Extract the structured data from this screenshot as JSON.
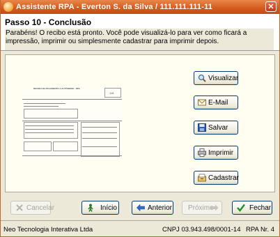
{
  "window": {
    "title": "Assistente RPA - Everton S. da Silva / 111.111.111-11",
    "close_label": "✕"
  },
  "step": {
    "title": "Passo 10 -  Conclusão",
    "description": "Parabéns! O recibo está pronto. Você pode visualizá-lo para ver como ficará a impressão, imprimir ou simplesmente cadastrar para imprimir depois."
  },
  "preview": {
    "heading": "RECIBO DE PAGAMENTO A AUTÔNOMO - RPA",
    "number": "118"
  },
  "actions": {
    "view_label": "Visualizar",
    "email_label": "E-Mail",
    "save_label": "Salvar",
    "print_label": "Imprimir",
    "register_label": "Cadastrar"
  },
  "nav": {
    "cancel_label": "Cancelar",
    "start_label": "Início",
    "previous_label": "Anterior",
    "next_label": "Próximo",
    "finish_label": "Fechar"
  },
  "status": {
    "company": "Neo Tecnologia Interativa Ltda",
    "cnpj": "CNPJ 03.943.498/0001-14",
    "rpa_number": "RPA Nr. 4"
  },
  "colors": {
    "titlebar": "#d45a1c",
    "panel": "#ece9d8",
    "content_bg": "#fffef0"
  }
}
